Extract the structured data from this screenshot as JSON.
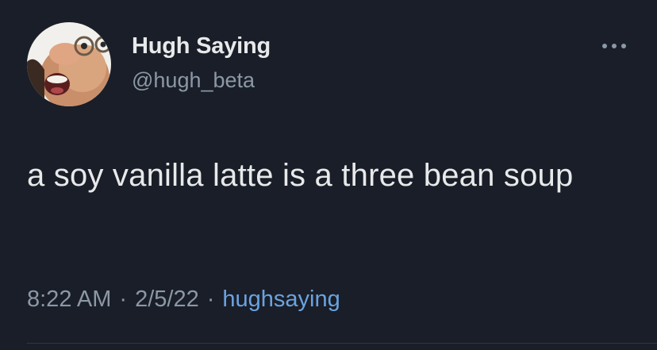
{
  "author": {
    "display_name": "Hugh Saying",
    "handle": "@hugh_beta"
  },
  "tweet": {
    "text": "a soy vanilla latte is a three bean soup",
    "time": "8:22 AM",
    "date": "2/5/22",
    "source": "hughsaying"
  },
  "icons": {
    "more": "more-horizontal-icon",
    "avatar": "avatar-image"
  },
  "colors": {
    "background": "#1a1e28",
    "primary_text": "#e7e9ea",
    "secondary_text": "#8b98a5",
    "link": "#6aa3e0"
  }
}
